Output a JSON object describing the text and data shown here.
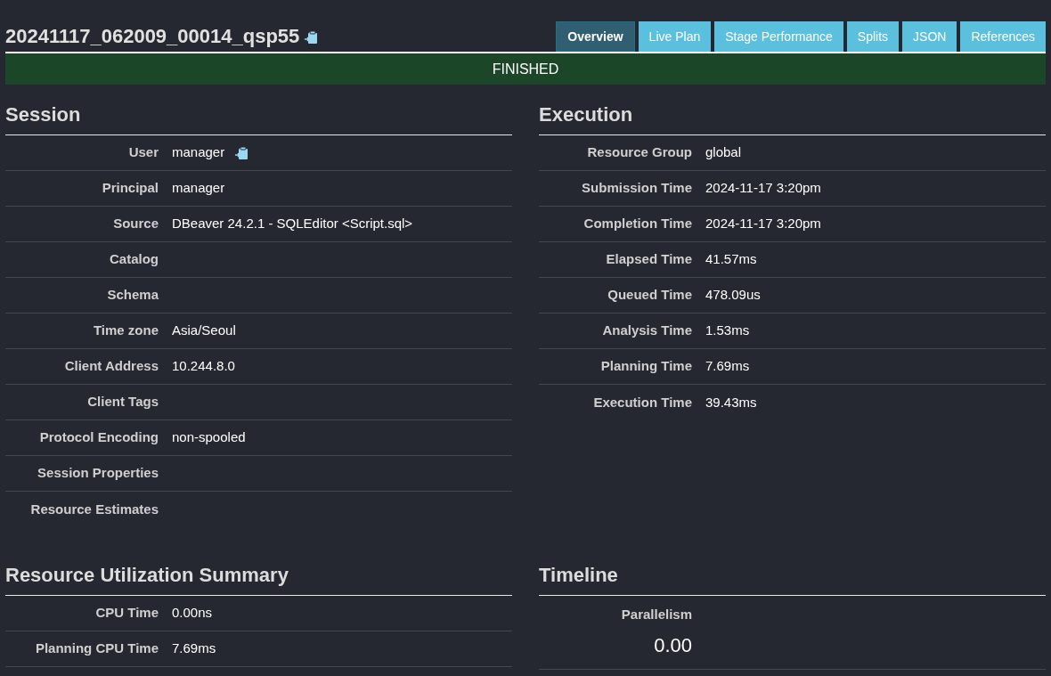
{
  "query_id": "20241117_062009_00014_qsp55",
  "tabs": [
    {
      "label": "Overview",
      "selected": true
    },
    {
      "label": "Live Plan",
      "selected": false
    },
    {
      "label": "Stage Performance",
      "selected": false
    },
    {
      "label": "Splits",
      "selected": false
    },
    {
      "label": "JSON",
      "selected": false
    },
    {
      "label": "References",
      "selected": false
    }
  ],
  "state": "FINISHED",
  "session": {
    "title": "Session",
    "rows": [
      {
        "label": "User",
        "value": "manager",
        "copyable": true
      },
      {
        "label": "Principal",
        "value": "manager"
      },
      {
        "label": "Source",
        "value": "DBeaver 24.2.1 - SQLEditor <Script.sql>"
      },
      {
        "label": "Catalog"
      },
      {
        "label": "Schema"
      },
      {
        "label": "Time zone",
        "value": "Asia/Seoul"
      },
      {
        "label": "Client Address",
        "value": "10.244.8.0"
      },
      {
        "label": "Client Tags"
      },
      {
        "label": "Protocol Encoding",
        "value": "non-spooled"
      },
      {
        "label": "Session Properties"
      },
      {
        "label": "Resource Estimates"
      }
    ]
  },
  "execution": {
    "title": "Execution",
    "rows": [
      {
        "label": "Resource Group",
        "value": "global"
      },
      {
        "label": "Submission Time",
        "value": "2024-11-17 3:20pm"
      },
      {
        "label": "Completion Time",
        "value": "2024-11-17 3:20pm"
      },
      {
        "label": "Elapsed Time",
        "value": "41.57ms"
      },
      {
        "label": "Queued Time",
        "value": "478.09us"
      },
      {
        "label": "Analysis Time",
        "value": "1.53ms"
      },
      {
        "label": "Planning Time",
        "value": "7.69ms"
      },
      {
        "label": "Execution Time",
        "value": "39.43ms"
      }
    ]
  },
  "resource_utilization": {
    "title": "Resource Utilization Summary",
    "rows": [
      {
        "label": "CPU Time",
        "value": "0.00ns"
      },
      {
        "label": "Planning CPU Time",
        "value": "7.69ms"
      }
    ]
  },
  "timeline": {
    "title": "Timeline",
    "metrics": [
      {
        "label": "Parallelism",
        "value": "0.00"
      }
    ]
  }
}
